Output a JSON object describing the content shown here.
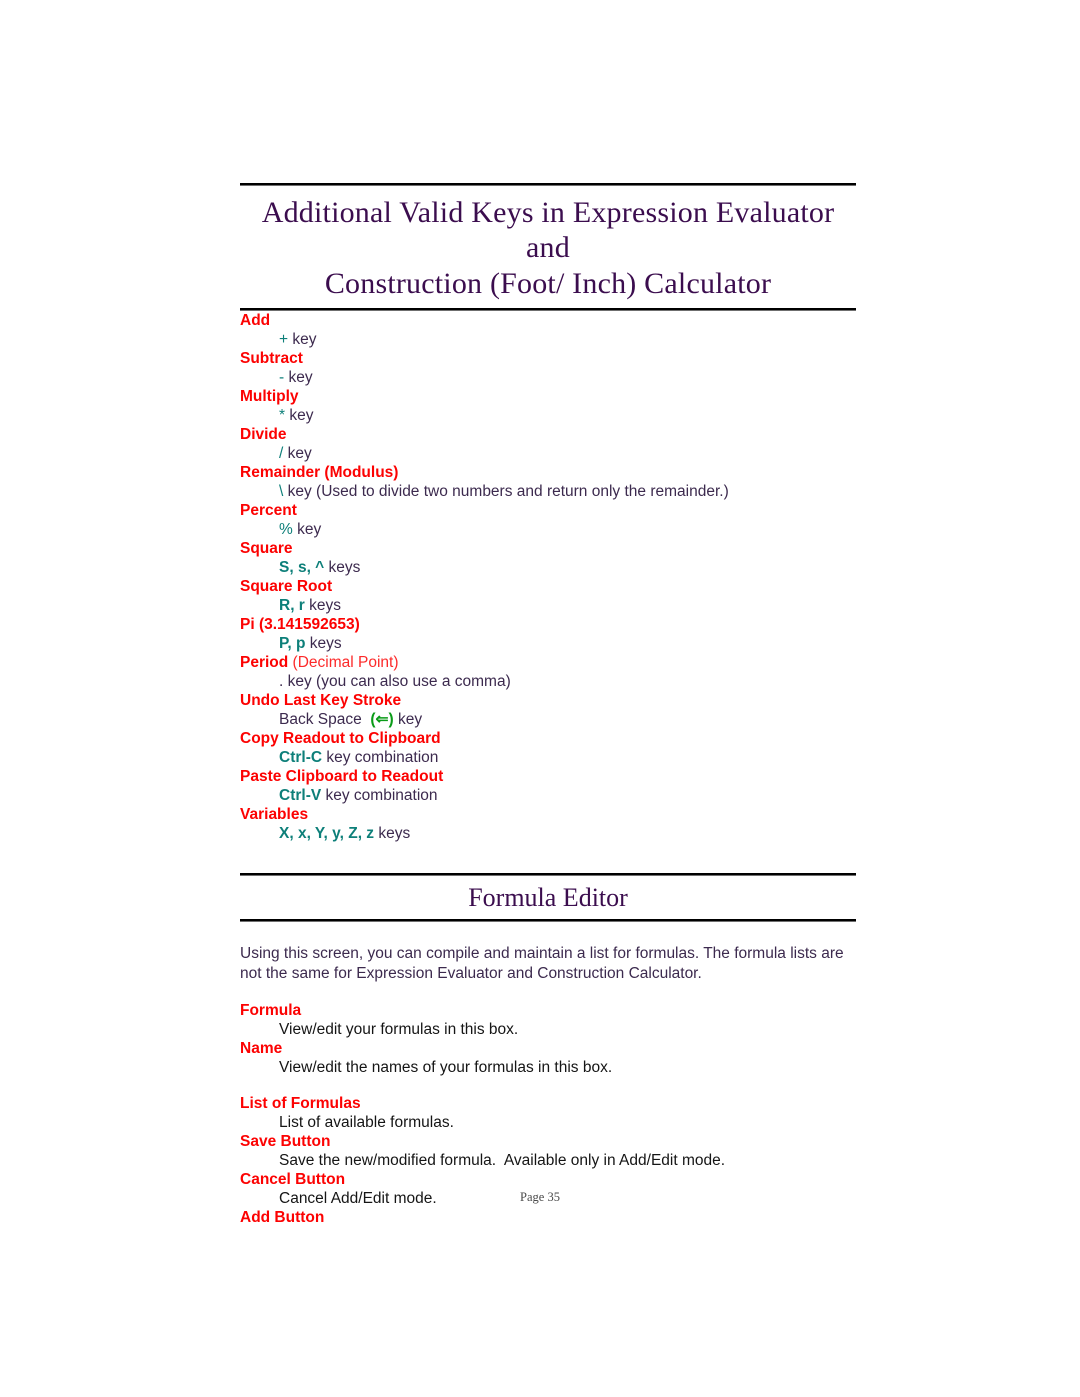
{
  "document": {
    "title_line1": "Additional Valid Keys in Expression Evaluator and",
    "title_line2": "Construction (Foot/ Inch) Calculator",
    "footer": "Page 35"
  },
  "keys_section": {
    "entries": [
      {
        "term": "Add",
        "term_sub": "",
        "key": "+",
        "key_style": "plain",
        "rest": " key"
      },
      {
        "term": "Subtract",
        "term_sub": "",
        "key": "-",
        "key_style": "plain",
        "rest": " key"
      },
      {
        "term": "Multiply",
        "term_sub": "",
        "key": "*",
        "key_style": "plain",
        "rest": " key"
      },
      {
        "term": "Divide",
        "term_sub": "",
        "key": "/",
        "key_style": "plain",
        "rest": " key"
      },
      {
        "term": "Remainder (Modulus)",
        "term_sub": "",
        "key": "\\",
        "key_style": "plain",
        "rest": " key (Used to divide two numbers and return only the remainder.)"
      },
      {
        "term": "Percent",
        "term_sub": "",
        "key": "%",
        "key_style": "plain",
        "rest": " key"
      },
      {
        "term": "Square",
        "term_sub": "",
        "key": "S, s, ^",
        "key_style": "bold",
        "rest": " keys"
      },
      {
        "term": "Square Root",
        "term_sub": "",
        "key": "R, r",
        "key_style": "bold",
        "rest": " keys"
      },
      {
        "term": "Pi (3.141592653)",
        "term_sub": "",
        "key": "P, p",
        "key_style": "bold",
        "rest": " keys"
      },
      {
        "term": "Period",
        "term_sub": " (Decimal Point)",
        "key": ".",
        "key_style": "none",
        "rest": " key (you can also use a comma)"
      },
      {
        "term": "Undo Last Key Stroke",
        "term_sub": "",
        "pre": "Back Space  ",
        "key": "(⇐)",
        "key_style": "green",
        "rest": " key"
      },
      {
        "term": "Copy Readout to Clipboard",
        "term_sub": "",
        "key": "Ctrl-C",
        "key_style": "bold",
        "rest": " key combination"
      },
      {
        "term": "Paste Clipboard to Readout",
        "term_sub": "",
        "key": "Ctrl-V",
        "key_style": "bold",
        "rest": " key combination"
      },
      {
        "term": "Variables",
        "term_sub": "",
        "key": "X, x, Y, y, Z, z",
        "key_style": "bold",
        "rest": " keys"
      }
    ]
  },
  "formula_editor": {
    "heading": "Formula Editor",
    "intro": "Using this screen, you can compile and maintain a list for formulas.  The formula lists are not the same for Expression Evaluator and Construction Calculator.",
    "entries": [
      {
        "term": "Formula",
        "desc": "View/edit your formulas in this box.",
        "gap_after": false
      },
      {
        "term": "Name",
        "desc": "View/edit the names of your formulas in this box.",
        "gap_after": true
      },
      {
        "term": "List of Formulas",
        "desc": "List of available formulas.",
        "gap_after": false
      },
      {
        "term": "Save Button",
        "desc": "Save the new/modified formula.  Available only in Add/Edit mode.",
        "gap_after": false
      },
      {
        "term": "Cancel Button",
        "desc": "Cancel Add/Edit mode.",
        "gap_after": false
      },
      {
        "term": "Add Button",
        "desc": "",
        "gap_after": false
      }
    ]
  },
  "colors": {
    "heading_purple": "#3b0d4e",
    "term_red": "#fc0202",
    "key_teal": "#0d7f79",
    "key_green": "#0a9b18",
    "body_purple": "#3c2a4e",
    "body_black": "#151515"
  }
}
